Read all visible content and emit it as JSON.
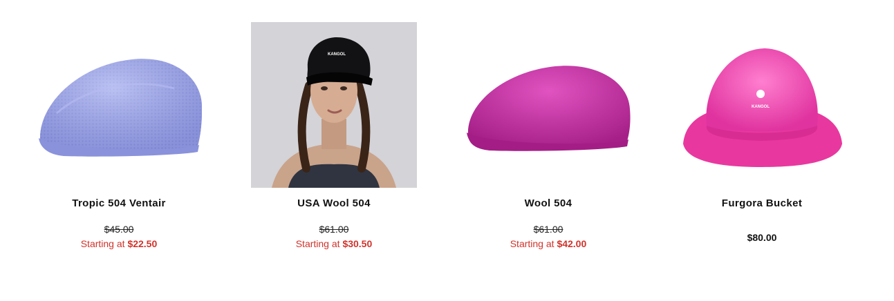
{
  "products": [
    {
      "name": "Tropic 504 Ventair",
      "image_alt": "Periwinkle flat cap",
      "original_price": "$45.00",
      "sale_prefix": "Starting at",
      "sale_price": "$22.50"
    },
    {
      "name": "USA Wool 504",
      "image_alt": "Model wearing black cap",
      "original_price": "$61.00",
      "sale_prefix": "Starting at",
      "sale_price": "$30.50"
    },
    {
      "name": "Wool 504",
      "image_alt": "Magenta flat cap",
      "original_price": "$61.00",
      "sale_prefix": "Starting at",
      "sale_price": "$42.00"
    },
    {
      "name": "Furgora Bucket",
      "image_alt": "Pink furry bucket hat",
      "price": "$80.00"
    }
  ],
  "colors": {
    "sale": "#d0332b",
    "periwinkle": "#9aa3e6",
    "magenta": "#cc2fa6",
    "pink": "#f04fb0"
  },
  "brand_logo_text": "KANGOL"
}
